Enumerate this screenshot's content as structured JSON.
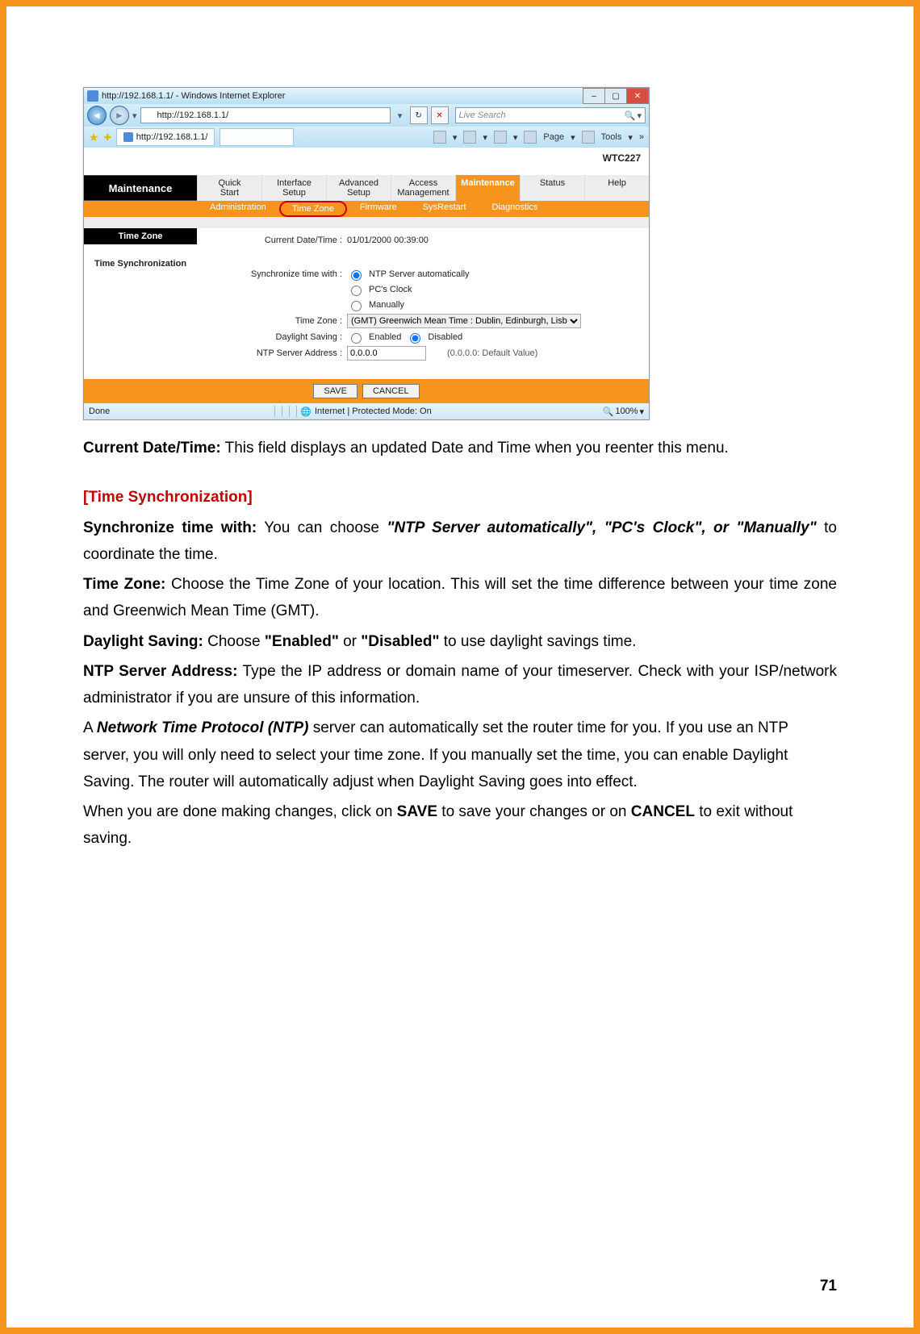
{
  "page_number": "71",
  "browser": {
    "window_title": "http://192.168.1.1/ - Windows Internet Explorer",
    "url": "http://192.168.1.1/",
    "tab_title": "http://192.168.1.1/",
    "search_placeholder": "Live Search",
    "page_menu": "Page",
    "tools_menu": "Tools",
    "status_done": "Done",
    "status_zone": "Internet | Protected Mode: On",
    "zoom": "100%"
  },
  "router": {
    "brand": "WTC227",
    "section_title": "Maintenance",
    "tabs": [
      "Quick Start",
      "Interface Setup",
      "Advanced Setup",
      "Access Management",
      "Maintenance",
      "Status",
      "Help"
    ],
    "active_tab": "Maintenance",
    "subtabs": [
      "Administration",
      "Time Zone",
      "Firmware",
      "SysRestart",
      "Diagnostics"
    ],
    "active_subtab": "Time Zone",
    "timezone_header": "Time Zone",
    "timesync_header": "Time Synchronization",
    "current_dt_label": "Current Date/Time :",
    "current_dt_value": "01/01/2000 00:39:00",
    "sync_label": "Synchronize time with :",
    "sync_opt1": "NTP Server automatically",
    "sync_opt2": "PC's Clock",
    "sync_opt3": "Manually",
    "tz_label": "Time Zone :",
    "tz_value": "(GMT) Greenwich Mean Time : Dublin, Edinburgh, Lisbon, London",
    "ds_label": "Daylight Saving :",
    "ds_enabled": "Enabled",
    "ds_disabled": "Disabled",
    "ntp_label": "NTP Server Address :",
    "ntp_value": "0.0.0.0",
    "ntp_hint": "(0.0.0.0: Default Value)",
    "save": "SAVE",
    "cancel": "CANCEL"
  },
  "doc": {
    "p1_b": "Current Date/Time:",
    "p1_t": " This field displays an updated Date and Time when you reenter this menu.",
    "h2": "[Time Synchronization]",
    "p2_b": "Synchronize time with:",
    "p2_t1": " You can choose ",
    "p2_bi": "\"NTP Server automatically\", \"PC's Clock\", or \"Manually\"",
    "p2_t2": " to coordinate the time.",
    "p3_b": "Time Zone:",
    "p3_t": " Choose the Time Zone of your location. This will set the time difference between your time zone and Greenwich Mean Time (GMT).",
    "p4_b": "Daylight Saving:",
    "p4_t1": " Choose ",
    "p4_q1": "\"Enabled\"",
    "p4_t2": " or ",
    "p4_q2": "\"Disabled\"",
    "p4_t3": " to use daylight savings time.",
    "p5_b": "NTP Server Address:",
    "p5_t": " Type the IP address or domain name of your timeserver. Check with your ISP/network administrator if you are unsure of this information.",
    "p6_t1": "A ",
    "p6_bi": "Network Time Protocol (NTP)",
    "p6_t2": " server can automatically set the router time for you. If you use an NTP server, you will only need to select your time zone. If you manually set the time, you can enable Daylight Saving. The router will automatically adjust when Daylight Saving goes into effect.",
    "p7_t1": "When you are done making changes, click on ",
    "p7_b1": "SAVE",
    "p7_t2": " to save your changes or on ",
    "p7_b2": "CANCEL",
    "p7_t3": " to exit without saving."
  }
}
